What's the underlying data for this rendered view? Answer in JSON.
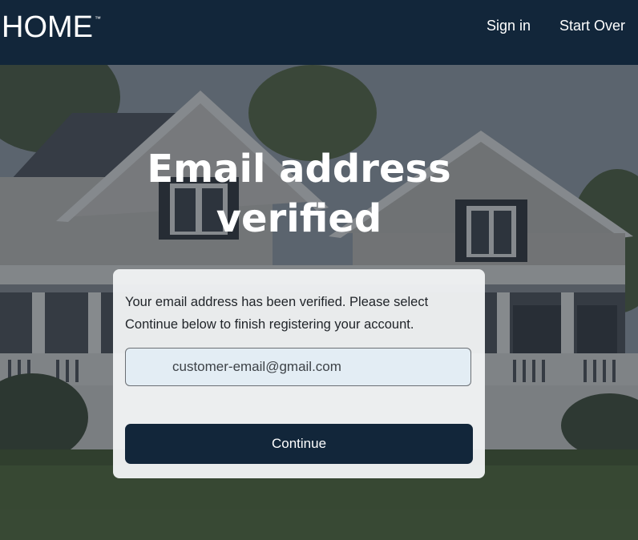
{
  "header": {
    "logo_text": "HOME",
    "logo_tm": "™",
    "nav": {
      "sign_in": "Sign in",
      "start_over": "Start Over"
    }
  },
  "main": {
    "title": "Email address verified",
    "message": "Your email address has been verified. Please select Continue below to finish registering your account.",
    "email_value": "customer-email@gmail.com",
    "continue_label": "Continue"
  },
  "colors": {
    "header_bg": "#12263a",
    "button_bg": "#12263a",
    "field_bg": "#e3edf4",
    "card_bg": "#f0f2f4"
  }
}
